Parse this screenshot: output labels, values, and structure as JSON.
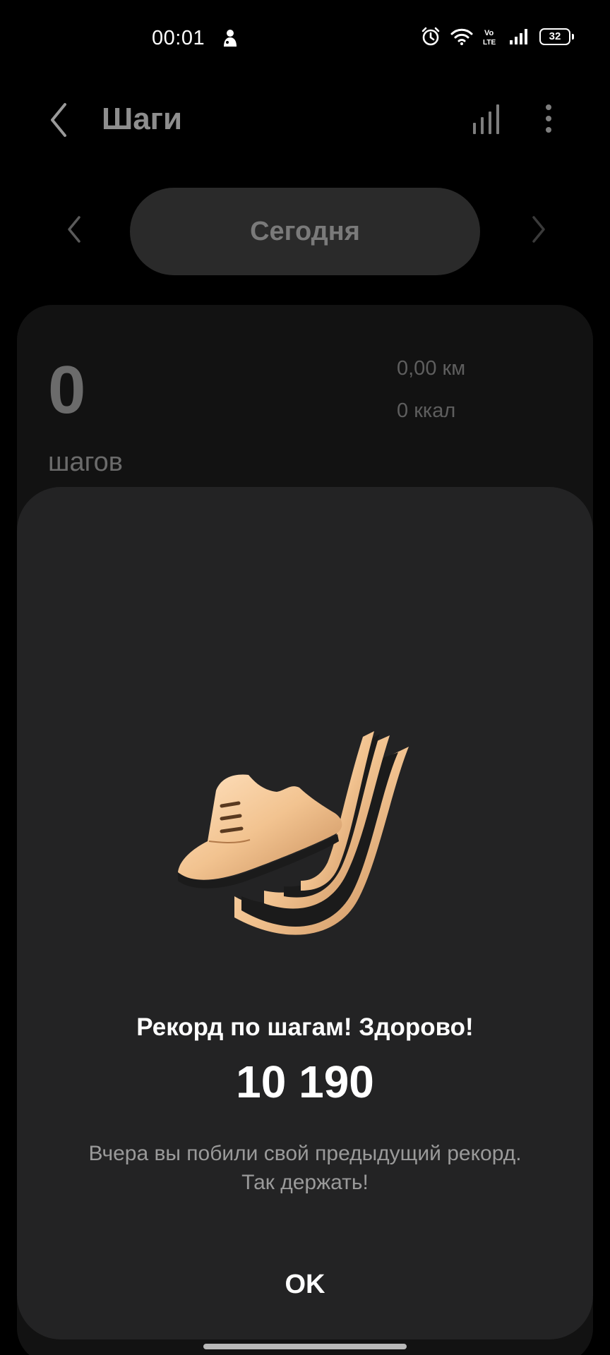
{
  "status_bar": {
    "time": "00:01",
    "battery_level": "32",
    "volte_label": "Vo LTE",
    "icons": [
      "notification-icon",
      "alarm-icon",
      "wifi-icon",
      "volte-icon",
      "signal-icon",
      "battery-icon"
    ]
  },
  "app_bar": {
    "title": "Шаги",
    "back_icon": "chevron-left-icon",
    "chart_icon": "bar-chart-icon",
    "more_icon": "more-vertical-icon"
  },
  "date_switcher": {
    "label": "Сегодня",
    "prev_icon": "chevron-left-icon",
    "next_icon": "chevron-right-icon"
  },
  "steps_card": {
    "steps": "0",
    "steps_unit": "шагов",
    "distance_value": "0,00",
    "distance_unit": "км",
    "calories_value": "0",
    "calories_unit": "ккал"
  },
  "achievement": {
    "heading": "Рекорд по шагам! Здорово!",
    "value": "10 190",
    "description": "Вчера вы побили свой предыдущий рекорд. Так держать!",
    "ok_label": "OK",
    "badge_icon": "shoe-badge-icon"
  },
  "colors": {
    "background": "#000000",
    "sheet": "#232324",
    "card": "#121212",
    "gold": "#f3c79a",
    "muted_text": "#9a9a9a"
  }
}
